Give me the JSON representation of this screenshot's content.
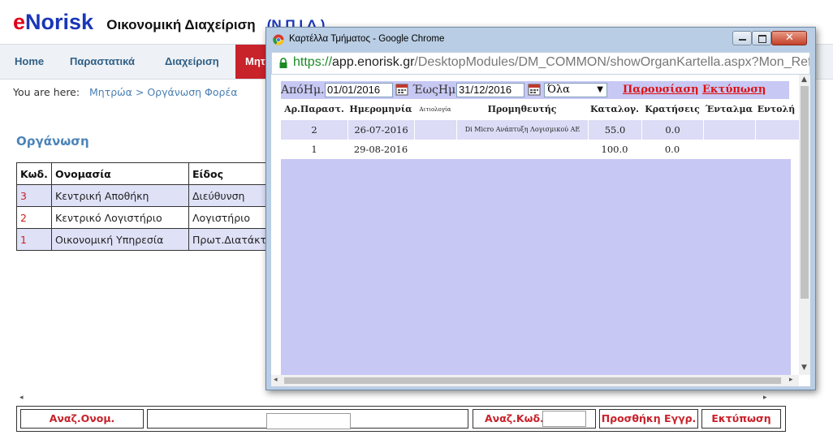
{
  "app": {
    "brand_e": "e",
    "brand_rest": "Norisk",
    "brand_sub": "Οικονομική Διαχείριση",
    "brand_sub2": "(Ν.Π.Ι.Δ.)"
  },
  "nav": {
    "items": [
      "Home",
      "Παραστατικά",
      "Διαχείριση"
    ],
    "active": "Μητρώα"
  },
  "breadcrumb": {
    "prefix": "You are here:",
    "path1": "Μητρώα",
    "sep": ">",
    "path2": "Οργάνωση Φορέα"
  },
  "section_title": "Οργάνωση",
  "org_table": {
    "headers": [
      "Κωδ.",
      "Ονομασία",
      "Είδος"
    ],
    "rows": [
      {
        "code": "3",
        "name": "Κεντρική Αποθήκη",
        "type": "Διεύθυνση"
      },
      {
        "code": "2",
        "name": "Κεντρικό Λογιστήριο",
        "type": "Λογιστήριο"
      },
      {
        "code": "1",
        "name": "Οικονομική Υπηρεσία",
        "type": "Πρωτ.Διατάκτης"
      }
    ]
  },
  "bottom_bar": {
    "search_name": "Αναζ.Ονομ.",
    "search_code": "Αναζ.Κωδ.",
    "add_record": "Προσθήκη Εγγρ.",
    "print": "Εκτύπωση"
  },
  "popup": {
    "title": "Καρτέλλα Τμήματος - Google Chrome",
    "url_scheme": "https://",
    "url_host": "app.enorisk.gr",
    "url_path": "/DesktopModules/DM_COMMON/showOrganKartella.aspx?Mon_Ref",
    "filter": {
      "from_label": "ΑπόΗμ.",
      "from_value": "01/01/2016",
      "to_label": "ΈωςΗμ.",
      "to_value": "31/12/2016",
      "select_value": "Όλα",
      "show_link": "Παρουσίαση",
      "print_link": "Εκτύπωση"
    },
    "grid": {
      "headers": [
        "Αρ.Παραστ.",
        "Ημερομηνία",
        "Αιτιολογία",
        "Προμηθευτής",
        "Καταλογ.",
        "Κρατήσεις",
        "Ένταλμα",
        "Εντολή"
      ],
      "rows": [
        {
          "num": "2",
          "date": "26-07-2016",
          "reason": "",
          "supplier": "Di Micro Ανάπτυξη Λογισμικού ΑΕ",
          "amount": "55.0",
          "deductions": "0.0",
          "warrant": "",
          "order": ""
        },
        {
          "num": "1",
          "date": "29-08-2016",
          "reason": "",
          "supplier": "",
          "amount": "100.0",
          "deductions": "0.0",
          "warrant": "",
          "order": ""
        }
      ]
    }
  }
}
